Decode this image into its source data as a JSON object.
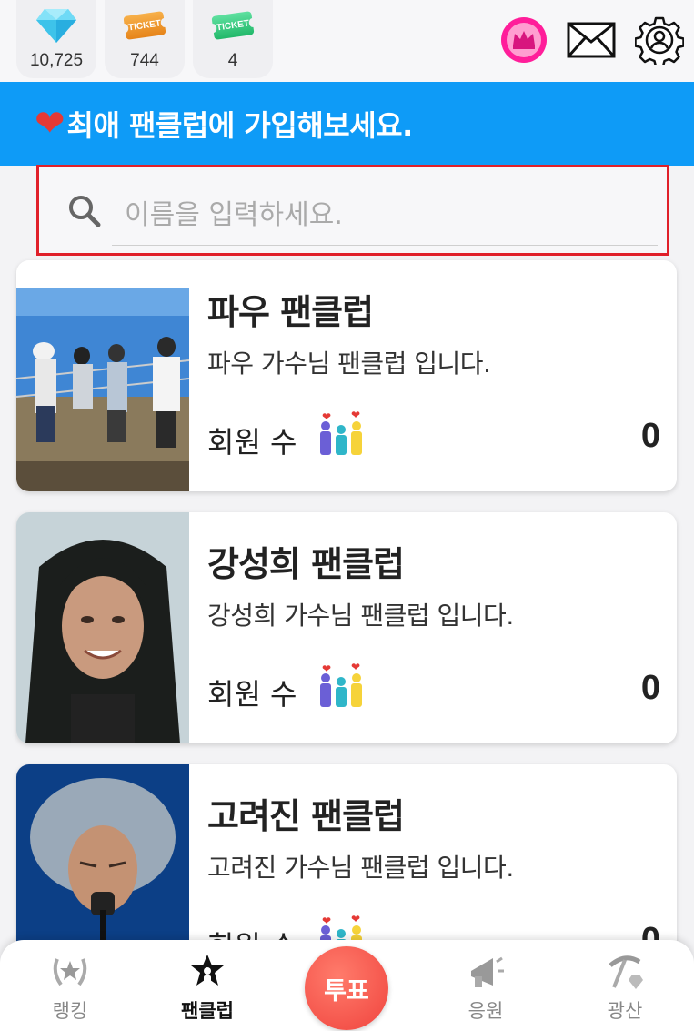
{
  "currencies": {
    "diamonds": "10,725",
    "tickets_orange": "744",
    "tickets_green": "4",
    "ticket_text": "TICKET"
  },
  "banner": {
    "text": "최애 팬클럽에 가입해보세요."
  },
  "search": {
    "placeholder": "이름을 입력하세요.",
    "value": ""
  },
  "fanclubs": [
    {
      "title": "파우 팬클럽",
      "description": "파우 가수님 팬클럽 입니다.",
      "members_label": "회원 수",
      "count": "0"
    },
    {
      "title": "강성희 팬클럽",
      "description": "강성희 가수님 팬클럽 입니다.",
      "members_label": "회원 수",
      "count": "0"
    },
    {
      "title": "고려진 팬클럽",
      "description": "고려진 가수님 팬클럽 입니다.",
      "members_label": "회원 수",
      "count": "0"
    }
  ],
  "nav": {
    "rank": "랭킹",
    "fanclub": "팬클럽",
    "vote": "투표",
    "cheer": "응원",
    "mine": "광산"
  },
  "colors": {
    "banner": "#0e9bf7",
    "highlight_border": "#e0202a",
    "vote_button": "#f0443e"
  }
}
